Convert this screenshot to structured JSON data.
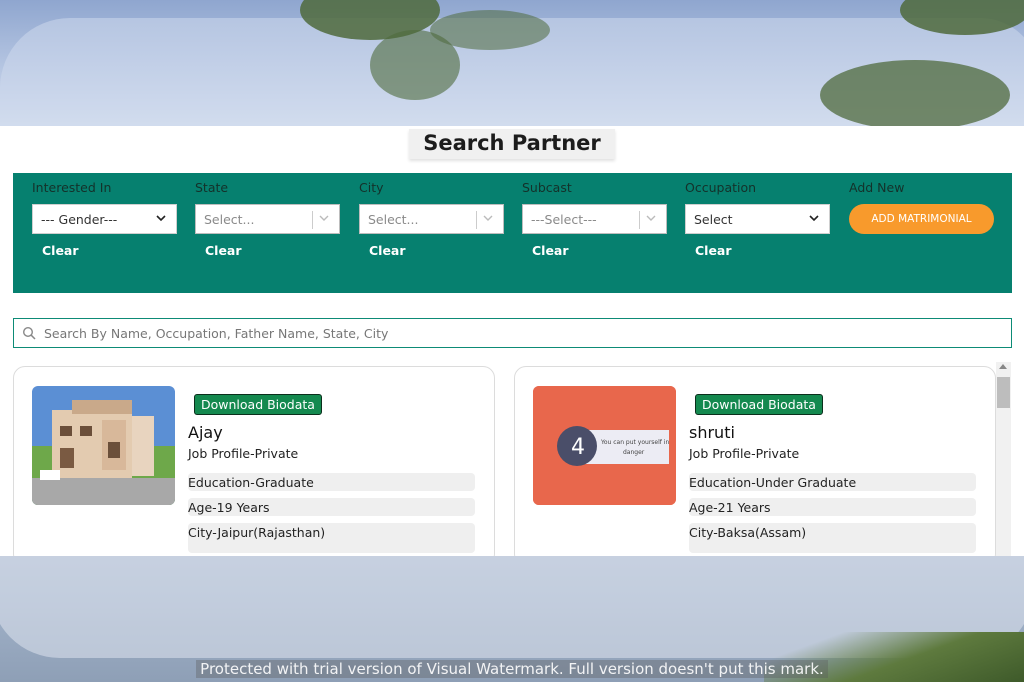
{
  "page": {
    "title": "Search Partner"
  },
  "filters": [
    {
      "label": "Interested In",
      "value": "--- Gender---",
      "clear": "Clear"
    },
    {
      "label": "State",
      "value": "Select...",
      "clear": "Clear"
    },
    {
      "label": "City",
      "value": "Select...",
      "clear": "Clear"
    },
    {
      "label": "Subcast",
      "value": "---Select---",
      "clear": "Clear"
    },
    {
      "label": "Occupation",
      "value": "Select",
      "clear": "Clear"
    }
  ],
  "add_new": {
    "label": "Add New",
    "button": "ADD MATRIMONIAL"
  },
  "search": {
    "placeholder": "Search By Name, Occupation, Father Name, State, City"
  },
  "profiles": [
    {
      "download": "Download Biodata",
      "name": "Ajay",
      "job": "Job Profile-Private",
      "education": "Education-Graduate",
      "age": "Age-19 Years",
      "city": "City-Jaipur(Rajasthan)"
    },
    {
      "download": "Download Biodata",
      "name": "shruti",
      "job": "Job Profile-Private",
      "education": "Education-Under Graduate",
      "age": "Age-21 Years",
      "city": "City-Baksa(Assam)",
      "photo_number": "4",
      "photo_caption": "You can put yourself in danger"
    }
  ],
  "watermark": "Protected with trial version of Visual Watermark. Full version doesn't put this mark.",
  "colors": {
    "panel": "#06806f",
    "accent_orange": "#f89a2c",
    "download_green": "#14894f"
  }
}
